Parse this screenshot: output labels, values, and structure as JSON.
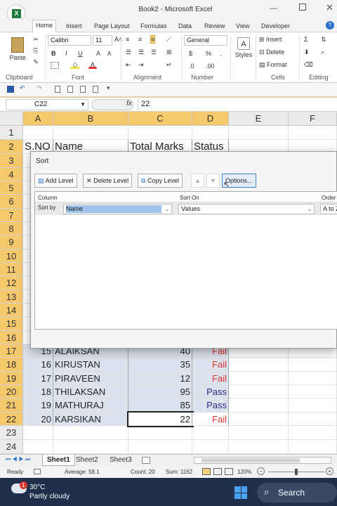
{
  "window": {
    "title": "Book2 - Microsoft Excel"
  },
  "tabs": [
    "Home",
    "Insert",
    "Page Layout",
    "Formulas",
    "Data",
    "Review",
    "View",
    "Developer"
  ],
  "active_tab": "Home",
  "ribbon": {
    "paste_label": "Paste",
    "font_name": "Calibri",
    "font_size": "11",
    "number_format": "General",
    "styles_label": "Styles",
    "insert_label": "Insert",
    "delete_label": "Delete",
    "format_label": "Format",
    "groups": {
      "clipboard": "Clipboard",
      "font": "Font",
      "alignment": "Alignment",
      "number": "Number",
      "cells": "Cells",
      "editing": "Editing"
    }
  },
  "formula_bar": {
    "name_box": "C22",
    "fx": "fx",
    "value": "22"
  },
  "columns": [
    "A",
    "B",
    "C",
    "D",
    "E",
    "F"
  ],
  "rows": [
    "1",
    "2",
    "3",
    "4",
    "5",
    "6",
    "7",
    "8",
    "9",
    "10",
    "11",
    "12",
    "13",
    "14",
    "15",
    "16",
    "17",
    "18",
    "19",
    "20",
    "21",
    "22",
    "23",
    "24"
  ],
  "header_row": {
    "a": "S.NO",
    "b": "Name",
    "c": "Total Marks",
    "d": "Status"
  },
  "data_rows": [
    {
      "sno": "15",
      "name": "ALAIKSAN",
      "marks": "40",
      "status": "Fail"
    },
    {
      "sno": "16",
      "name": "KIRUSTAN",
      "marks": "35",
      "status": "Fail"
    },
    {
      "sno": "17",
      "name": "PIRAVEEN",
      "marks": "12",
      "status": "Fail"
    },
    {
      "sno": "18",
      "name": "THILAKSAN",
      "marks": "95",
      "status": "Pass"
    },
    {
      "sno": "19",
      "name": "MATHURAJ",
      "marks": "85",
      "status": "Pass"
    },
    {
      "sno": "20",
      "name": "KARSIKAN",
      "marks": "22",
      "status": "Fail"
    }
  ],
  "colors": {
    "fail": "#e0302c",
    "pass": "#2a2a8a",
    "accent": "#1f6b3a"
  },
  "sort_dialog": {
    "title": "Sort",
    "add_level": "Add Level",
    "delete_level": "Delete Level",
    "copy_level": "Copy Level",
    "options": "Options...",
    "col_header": "Column",
    "sort_on_header": "Sort On",
    "order_header": "Order",
    "sort_by_label": "Sort by",
    "sort_by_value": "Name",
    "sort_on_value": "Values",
    "order_value": "A to Z"
  },
  "sheets": [
    "Sheet1",
    "Sheet2",
    "Sheet3"
  ],
  "status_bar": {
    "ready": "Ready",
    "average": "Average: 58.1",
    "count": "Count: 20",
    "sum": "Sum: 1162",
    "zoom": "120%"
  },
  "taskbar": {
    "temp": "30°C",
    "weather": "Partly cloudy",
    "search": "Search",
    "badge": "1"
  }
}
